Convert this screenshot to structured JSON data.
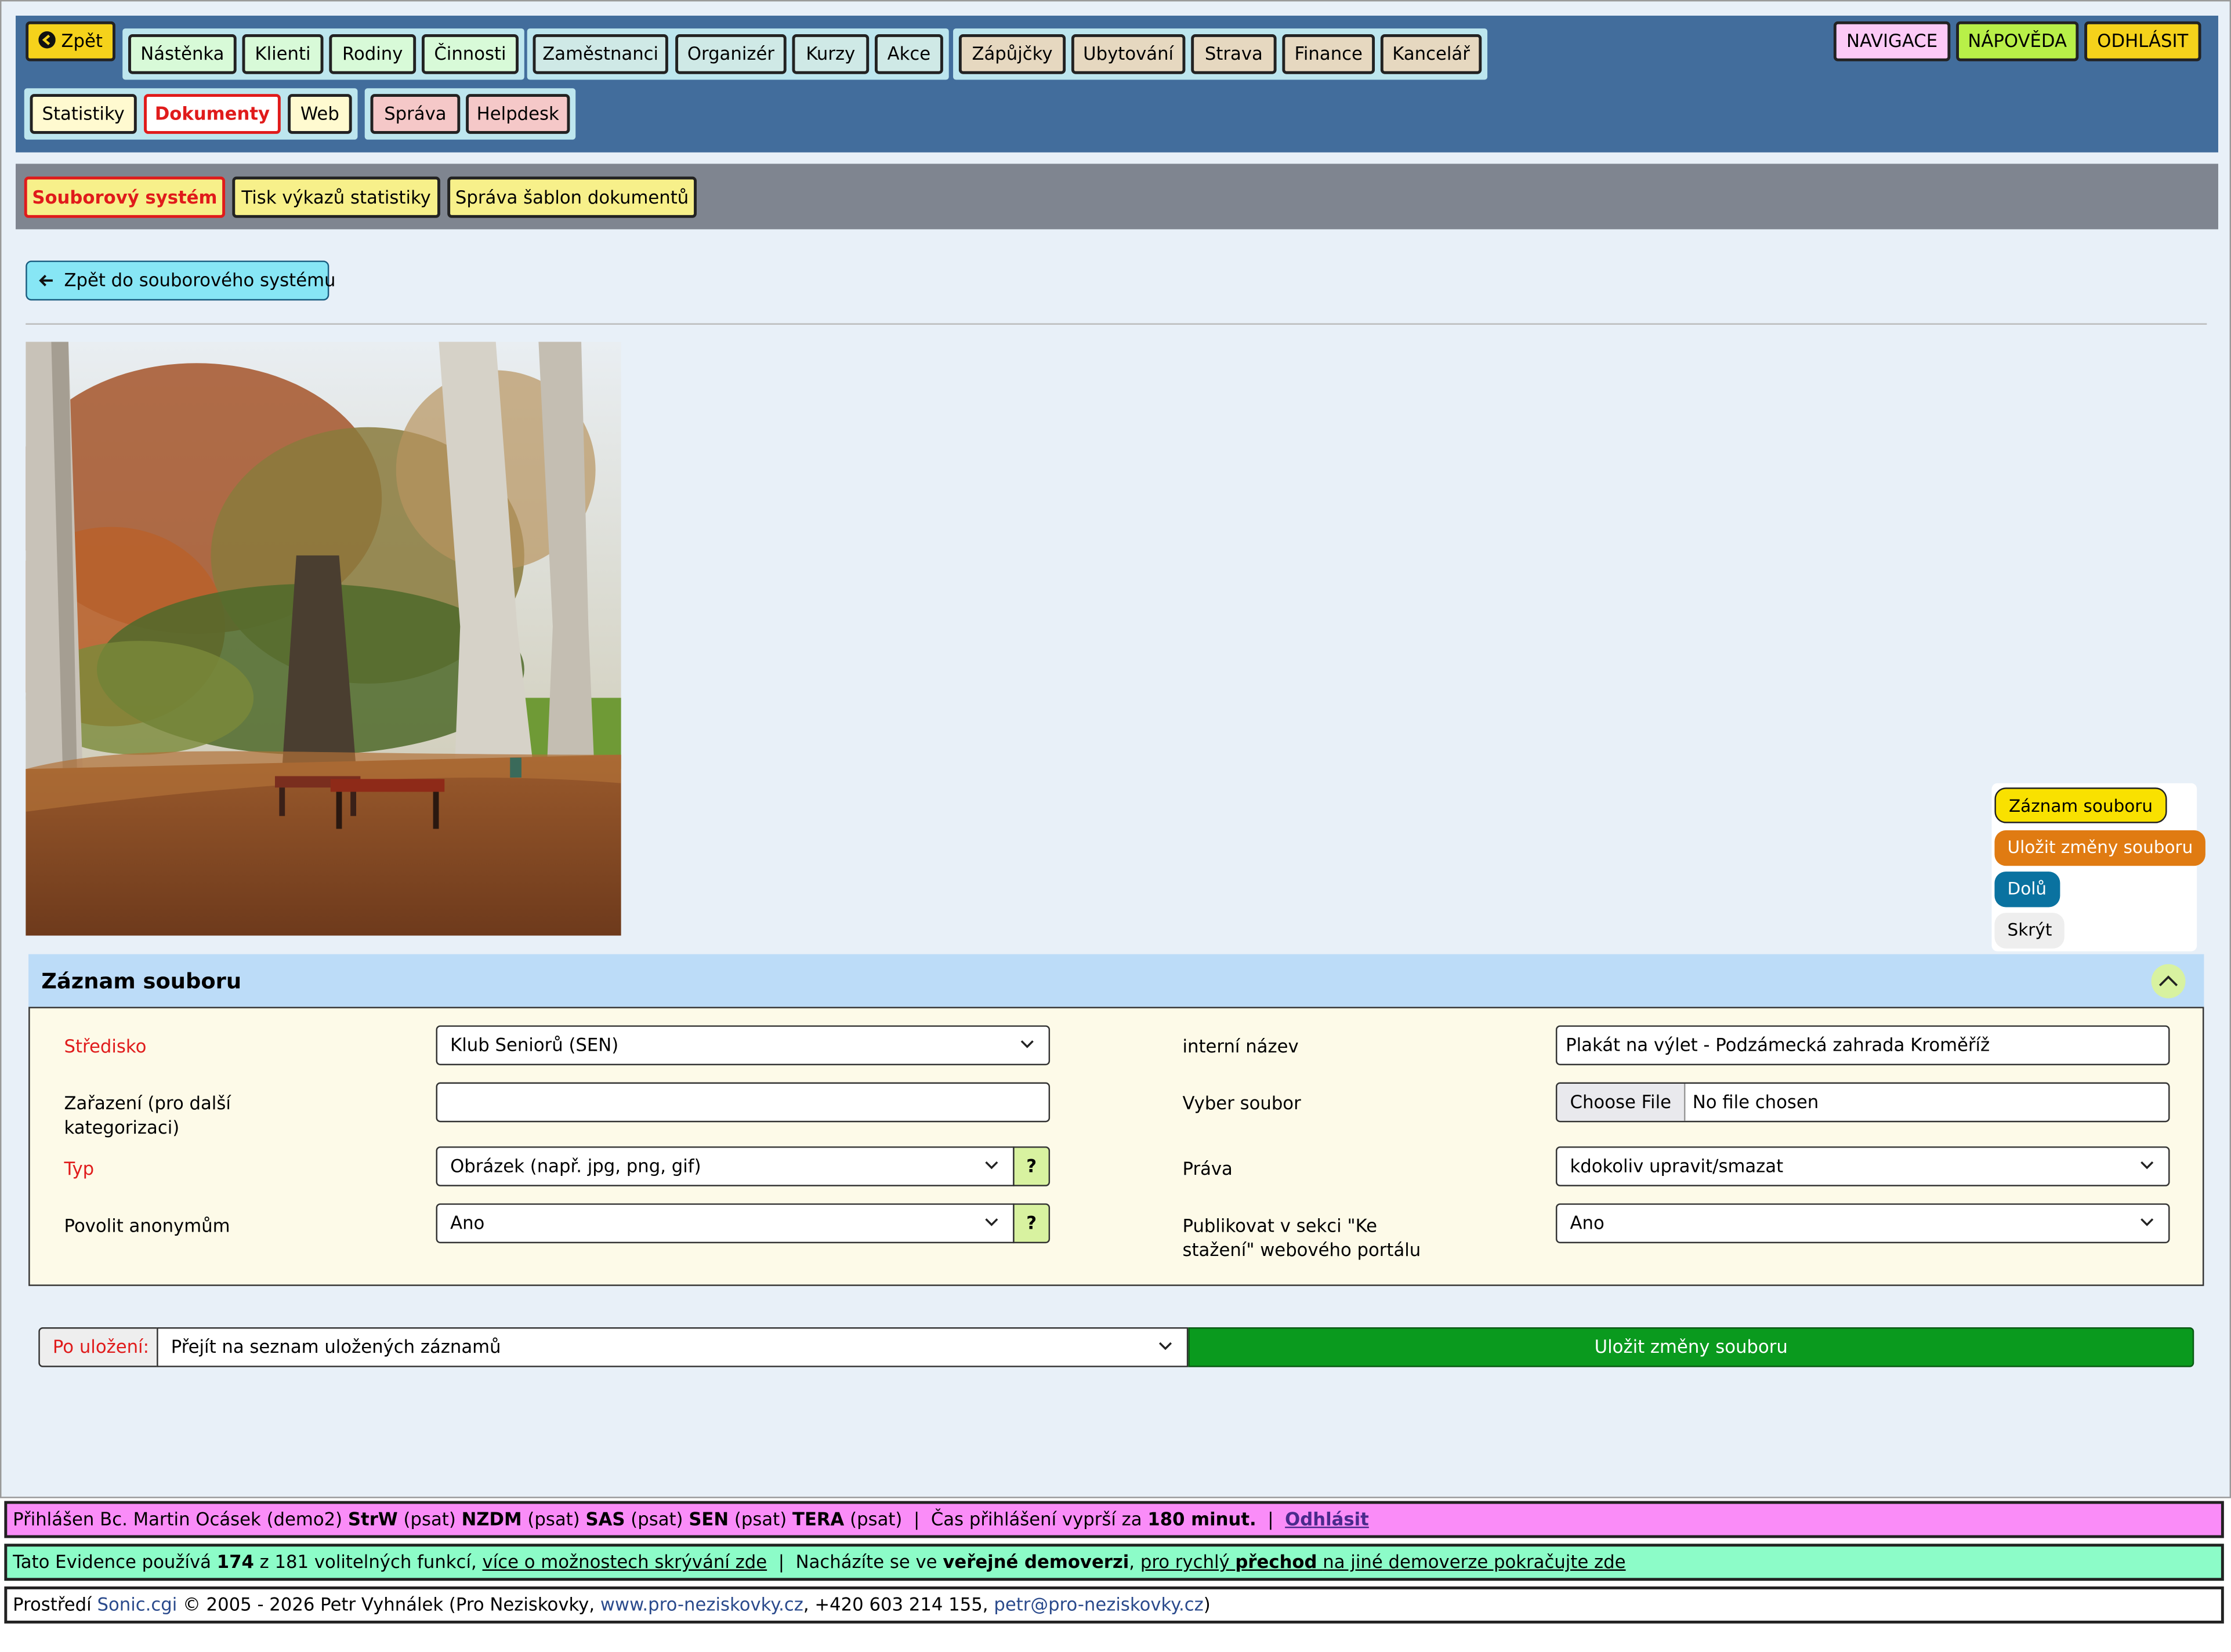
{
  "topbar": {
    "back_label": "Zpět",
    "group1": [
      "Nástěnka",
      "Klienti",
      "Rodiny",
      "Činnosti"
    ],
    "group2": [
      "Zaměstnanci",
      "Organizér",
      "Kurzy",
      "Akce"
    ],
    "group3": [
      "Zápůjčky",
      "Ubytování",
      "Strava",
      "Finance",
      "Kancelář"
    ],
    "row2_group1": [
      "Statistiky",
      "Dokumenty",
      "Web"
    ],
    "row2_group2": [
      "Správa",
      "Helpdesk"
    ],
    "right": [
      "NAVIGACE",
      "NÁPOVĚDA",
      "ODHLÁSIT"
    ]
  },
  "subbar": [
    "Souborový systém",
    "Tisk výkazů statistiky",
    "Správa šablon dokumentů"
  ],
  "back_fs_label": "Zpět do souborového systému",
  "float_panel": {
    "record": "Záznam souboru",
    "save": "Uložit změny souboru",
    "down": "Dolů",
    "hide": "Skrýt"
  },
  "section_title": "Záznam souboru",
  "form": {
    "stredisko_label": "Středisko",
    "stredisko_value": "Klub Seniorů (SEN)",
    "zarazeni_label": "Zařazení (pro další kategorizaci)",
    "zarazeni_value": "",
    "typ_label": "Typ",
    "typ_value": "Obrázek (např. jpg, png, gif)",
    "anon_label": "Povolit anonymům",
    "anon_value": "Ano",
    "help_q": "?",
    "interni_label": "interní název",
    "interni_value": "Plakát na výlet - Podzámecká zahrada Kroměříž",
    "vyber_label": "Vyber soubor",
    "choose_file": "Choose File",
    "no_file": "No file chosen",
    "prava_label": "Práva",
    "prava_value": "kdokoliv upravit/smazat",
    "publikovat_label": "Publikovat v sekci \"Ke stažení\" webového portálu",
    "publikovat_value": "Ano"
  },
  "save_row": {
    "po_ulozeni": "Po uložení:",
    "select_value": "Přejít na seznam uložených záznamů",
    "save_button": "Uložit změny souboru"
  },
  "status1": {
    "prefix": "Přihlášen Bc. Martin Ocásek (demo2)",
    "r1": "StrW",
    "r2": "NZDM",
    "r3": "SAS",
    "r4": "SEN",
    "r5": "TERA",
    "psat": "(psat)",
    "sep": "|",
    "timeout_text": "Čas přihlášení vyprší za",
    "timeout_value": "180 minut.",
    "logout": "Odhlásit"
  },
  "status2": {
    "t1": "Tato Evidence používá",
    "count": "174",
    "t2": "z 181 volitelných funkcí,",
    "link1": "více o možnostech skrývání zde",
    "sep": "|",
    "t3": "Nacházíte se ve",
    "demo": "veřejné demoverzi",
    "link2a": "pro rychlý",
    "link2b": "přechod",
    "link2c": "na jiné demoverze pokračujte zde"
  },
  "status3": {
    "t1": "Prostředí",
    "sonic": "Sonic.cgi",
    "t2": "© 2005 - 2026 Petr Vyhnálek (Pro Neziskovky,",
    "web": "www.pro-neziskovky.cz",
    "t3": ", +420 603 214 155,",
    "email": "petr@pro-neziskovky.cz",
    "t4": ")"
  }
}
